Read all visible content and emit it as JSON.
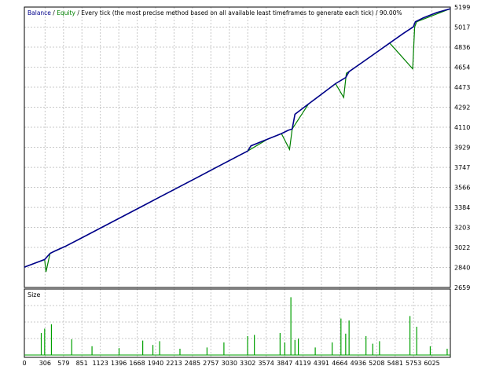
{
  "chart_data": [
    {
      "type": "line",
      "legend": {
        "balance_label": "Balance",
        "sep1": " / ",
        "equity_label": "Equity",
        "sep2": " / ",
        "description": "Every tick (the most precise method based on all available least timeframes to generate each tick)",
        "sep3": " / ",
        "quality": "90.00%",
        "placement": "top-left"
      },
      "colors": {
        "balance": "#00008b",
        "equity": "#008000",
        "grid": "#c8c8c8",
        "frame": "#000000"
      },
      "xlim": [
        0,
        6297
      ],
      "ylim": [
        2659,
        5199
      ],
      "x_ticks": [
        0,
        306,
        579,
        851,
        1123,
        1396,
        1668,
        1940,
        2213,
        2485,
        2757,
        3030,
        3302,
        3574,
        3847,
        4119,
        4391,
        4664,
        4936,
        5208,
        5481,
        5753,
        6025
      ],
      "y_ticks": [
        2659,
        2840,
        3022,
        3203,
        3384,
        3566,
        3747,
        3929,
        4110,
        4292,
        4473,
        4654,
        4836,
        5017,
        5199
      ],
      "grid": true,
      "series": [
        {
          "name": "Balance",
          "x": [
            0,
            150,
            300,
            380,
            450,
            600,
            800,
            1000,
            1200,
            1400,
            1600,
            1800,
            2000,
            2200,
            2400,
            2600,
            2800,
            3000,
            3200,
            3302,
            3350,
            3600,
            3800,
            3900,
            3960,
            4000,
            4200,
            4400,
            4600,
            4750,
            4800,
            5000,
            5200,
            5400,
            5600,
            5750,
            5780,
            5900,
            6100,
            6297
          ],
          "y": [
            2843,
            2878,
            2912,
            2968,
            2989,
            3030,
            3093,
            3157,
            3221,
            3285,
            3349,
            3413,
            3478,
            3542,
            3606,
            3670,
            3735,
            3799,
            3863,
            3895,
            3942,
            4004,
            4053,
            4083,
            4095,
            4228,
            4321,
            4413,
            4505,
            4560,
            4614,
            4700,
            4786,
            4873,
            4959,
            5020,
            5066,
            5102,
            5150,
            5184
          ]
        },
        {
          "name": "Equity",
          "x": [
            0,
            300,
            320,
            380,
            600,
            1000,
            1400,
            1800,
            2000,
            2400,
            2800,
            3200,
            3300,
            3600,
            3800,
            3920,
            3960,
            4200,
            4600,
            4720,
            4760,
            4800,
            5000,
            5400,
            5740,
            5770,
            5800,
            6297
          ],
          "y": [
            2843,
            2912,
            2800,
            2968,
            3030,
            3157,
            3285,
            3413,
            3478,
            3606,
            3735,
            3863,
            3895,
            4004,
            4053,
            3910,
            4095,
            4321,
            4505,
            4380,
            4600,
            4614,
            4700,
            4873,
            4640,
            5020,
            5066,
            5184
          ]
        }
      ]
    },
    {
      "type": "bar",
      "title": "Size",
      "xlim": [
        0,
        6297
      ],
      "ylim": [
        0,
        1
      ],
      "bar_color": "#00a000",
      "bars": [
        {
          "x": 250,
          "value": 0.35
        },
        {
          "x": 300,
          "value": 0.42
        },
        {
          "x": 400,
          "value": 0.49
        },
        {
          "x": 700,
          "value": 0.25
        },
        {
          "x": 1000,
          "value": 0.14
        },
        {
          "x": 1400,
          "value": 0.11
        },
        {
          "x": 1750,
          "value": 0.23
        },
        {
          "x": 1900,
          "value": 0.16
        },
        {
          "x": 2000,
          "value": 0.22
        },
        {
          "x": 2300,
          "value": 0.1
        },
        {
          "x": 2700,
          "value": 0.12
        },
        {
          "x": 2950,
          "value": 0.2
        },
        {
          "x": 3300,
          "value": 0.3
        },
        {
          "x": 3400,
          "value": 0.32
        },
        {
          "x": 3780,
          "value": 0.35
        },
        {
          "x": 3850,
          "value": 0.2
        },
        {
          "x": 3940,
          "value": 0.92
        },
        {
          "x": 4000,
          "value": 0.24
        },
        {
          "x": 4050,
          "value": 0.26
        },
        {
          "x": 4300,
          "value": 0.12
        },
        {
          "x": 4550,
          "value": 0.2
        },
        {
          "x": 4680,
          "value": 0.58
        },
        {
          "x": 4750,
          "value": 0.34
        },
        {
          "x": 4800,
          "value": 0.55
        },
        {
          "x": 5050,
          "value": 0.3
        },
        {
          "x": 5150,
          "value": 0.18
        },
        {
          "x": 5250,
          "value": 0.22
        },
        {
          "x": 5700,
          "value": 0.62
        },
        {
          "x": 5800,
          "value": 0.45
        },
        {
          "x": 6000,
          "value": 0.14
        },
        {
          "x": 6250,
          "value": 0.1
        }
      ]
    }
  ]
}
